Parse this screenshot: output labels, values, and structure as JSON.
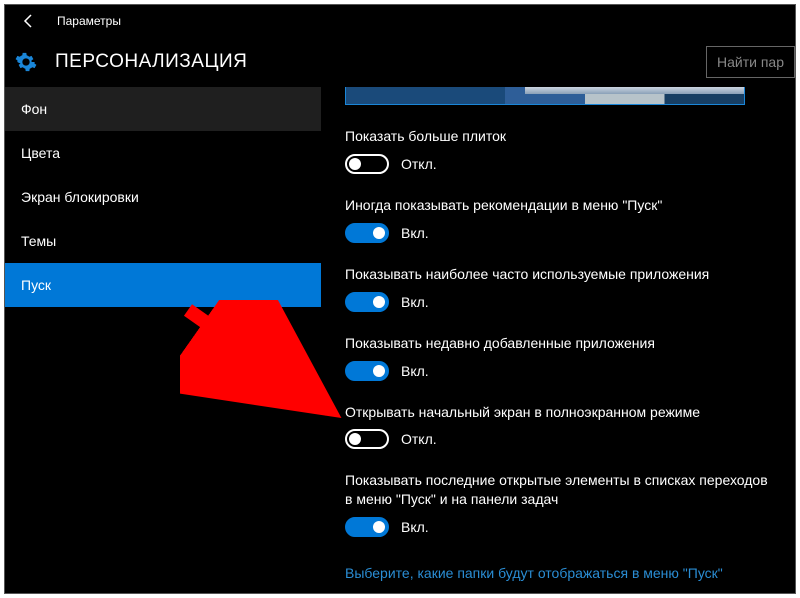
{
  "window": {
    "title": "Параметры"
  },
  "header": {
    "heading": "ПЕРСОНАЛИЗАЦИЯ",
    "search_placeholder": "Найти пар"
  },
  "sidebar": {
    "items": [
      {
        "label": "Фон",
        "selected": false,
        "hint": true
      },
      {
        "label": "Цвета",
        "selected": false
      },
      {
        "label": "Экран блокировки",
        "selected": false
      },
      {
        "label": "Темы",
        "selected": false
      },
      {
        "label": "Пуск",
        "selected": true
      }
    ]
  },
  "toggleStates": {
    "on": "Вкл.",
    "off": "Откл."
  },
  "settings": [
    {
      "label": "Показать больше плиток",
      "on": false
    },
    {
      "label": "Иногда показывать рекомендации в меню \"Пуск\"",
      "on": true
    },
    {
      "label": "Показывать наиболее часто используемые приложения",
      "on": true
    },
    {
      "label": "Показывать недавно добавленные приложения",
      "on": true
    },
    {
      "label": "Открывать начальный экран в полноэкранном режиме",
      "on": false
    },
    {
      "label": "Показывать последние открытые элементы в списках переходов в меню \"Пуск\" и на панели задач",
      "on": true
    }
  ],
  "link": "Выберите, какие папки будут отображаться в меню \"Пуск\"",
  "annotation": {
    "type": "arrow",
    "color": "#ff0000"
  },
  "colors": {
    "accent": "#0078d7",
    "link": "#2a8dd4"
  }
}
